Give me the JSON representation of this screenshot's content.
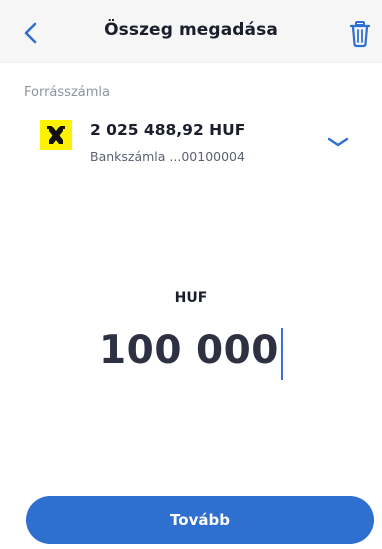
{
  "header": {
    "title": "Összeg megadása",
    "back_icon": "chevron-left-icon",
    "delete_icon": "trash-icon"
  },
  "source": {
    "label": "Forrásszámla",
    "account": {
      "balance": "2 025 488,92 HUF",
      "name": "Bankszámla ...00100004",
      "logo_icon": "bank-logo-icon",
      "expand_icon": "chevron-down-icon"
    }
  },
  "amount": {
    "currency": "HUF",
    "value": "100 000"
  },
  "footer": {
    "next_label": "Tovább"
  },
  "colors": {
    "accent": "#2f6fd0",
    "logo_yellow": "#fff200",
    "text": "#1b1e2b"
  }
}
